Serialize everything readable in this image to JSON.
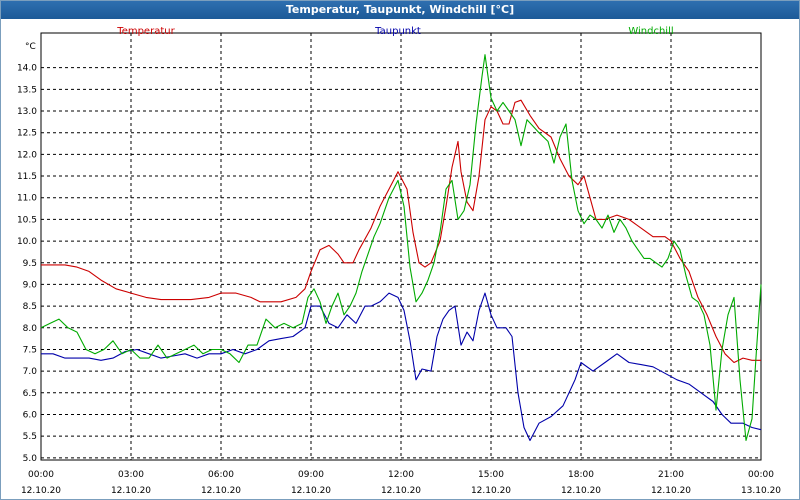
{
  "window": {
    "title": "Temperatur, Taupunkt, Windchill [°C]"
  },
  "chart_data": {
    "type": "line",
    "title": "Temperatur, Taupunkt, Windchill [°C]",
    "ylabel": "°C",
    "ylim": [
      4.95,
      14.8
    ],
    "xlim": [
      0,
      24
    ],
    "grid": true,
    "legend_position": "top",
    "y_ticks": [
      "5.0",
      "5.5",
      "6.0",
      "6.5",
      "7.0",
      "7.5",
      "8.0",
      "8.5",
      "9.0",
      "9.5",
      "10.0",
      "10.5",
      "11.0",
      "11.5",
      "12.0",
      "12.5",
      "13.0",
      "13.5",
      "14.0"
    ],
    "x_ticks": [
      {
        "time": "00:00",
        "date": "12.10.20"
      },
      {
        "time": "03:00",
        "date": "12.10.20"
      },
      {
        "time": "06:00",
        "date": "12.10.20"
      },
      {
        "time": "09:00",
        "date": "12.10.20"
      },
      {
        "time": "12:00",
        "date": "12.10.20"
      },
      {
        "time": "15:00",
        "date": "12.10.20"
      },
      {
        "time": "18:00",
        "date": "12.10.20"
      },
      {
        "time": "21:00",
        "date": "12.10.20"
      },
      {
        "time": "00:00",
        "date": "13.10.20"
      }
    ],
    "series": [
      {
        "name": "Temperatur",
        "color": "#cc0000",
        "points": [
          [
            0,
            9.45
          ],
          [
            0.8,
            9.45
          ],
          [
            1.2,
            9.4
          ],
          [
            1.6,
            9.3
          ],
          [
            2.0,
            9.1
          ],
          [
            2.5,
            8.9
          ],
          [
            3.0,
            8.8
          ],
          [
            3.5,
            8.7
          ],
          [
            4.0,
            8.65
          ],
          [
            5.0,
            8.65
          ],
          [
            5.6,
            8.7
          ],
          [
            6.0,
            8.8
          ],
          [
            6.5,
            8.8
          ],
          [
            7.0,
            8.7
          ],
          [
            7.3,
            8.6
          ],
          [
            7.6,
            8.6
          ],
          [
            8.0,
            8.6
          ],
          [
            8.5,
            8.7
          ],
          [
            8.8,
            8.9
          ],
          [
            9.0,
            9.3
          ],
          [
            9.3,
            9.8
          ],
          [
            9.6,
            9.9
          ],
          [
            9.9,
            9.7
          ],
          [
            10.1,
            9.5
          ],
          [
            10.4,
            9.5
          ],
          [
            10.6,
            9.8
          ],
          [
            11.0,
            10.3
          ],
          [
            11.3,
            10.8
          ],
          [
            11.6,
            11.2
          ],
          [
            11.9,
            11.6
          ],
          [
            12.2,
            11.2
          ],
          [
            12.4,
            10.2
          ],
          [
            12.6,
            9.5
          ],
          [
            12.8,
            9.4
          ],
          [
            13.0,
            9.5
          ],
          [
            13.3,
            10.0
          ],
          [
            13.5,
            10.8
          ],
          [
            13.7,
            11.7
          ],
          [
            13.9,
            12.3
          ],
          [
            14.0,
            11.6
          ],
          [
            14.2,
            10.9
          ],
          [
            14.4,
            10.7
          ],
          [
            14.6,
            11.5
          ],
          [
            14.8,
            12.8
          ],
          [
            15.0,
            13.1
          ],
          [
            15.2,
            13.0
          ],
          [
            15.4,
            12.7
          ],
          [
            15.6,
            12.7
          ],
          [
            15.8,
            13.2
          ],
          [
            16.0,
            13.25
          ],
          [
            16.3,
            12.9
          ],
          [
            16.6,
            12.6
          ],
          [
            17.0,
            12.4
          ],
          [
            17.3,
            11.9
          ],
          [
            17.6,
            11.5
          ],
          [
            17.9,
            11.3
          ],
          [
            18.1,
            11.5
          ],
          [
            18.3,
            11.0
          ],
          [
            18.5,
            10.5
          ],
          [
            18.8,
            10.5
          ],
          [
            19.2,
            10.6
          ],
          [
            19.6,
            10.5
          ],
          [
            20.0,
            10.3
          ],
          [
            20.4,
            10.1
          ],
          [
            20.8,
            10.1
          ],
          [
            21.0,
            10.0
          ],
          [
            21.3,
            9.6
          ],
          [
            21.6,
            9.3
          ],
          [
            21.9,
            8.7
          ],
          [
            22.2,
            8.3
          ],
          [
            22.5,
            7.8
          ],
          [
            22.8,
            7.4
          ],
          [
            23.1,
            7.2
          ],
          [
            23.4,
            7.3
          ],
          [
            23.7,
            7.25
          ],
          [
            24.0,
            7.25
          ]
        ]
      },
      {
        "name": "Taupunkt",
        "color": "#0000aa",
        "points": [
          [
            0,
            7.4
          ],
          [
            0.4,
            7.4
          ],
          [
            0.8,
            7.3
          ],
          [
            1.2,
            7.3
          ],
          [
            1.6,
            7.3
          ],
          [
            2.0,
            7.25
          ],
          [
            2.4,
            7.3
          ],
          [
            2.8,
            7.45
          ],
          [
            3.2,
            7.5
          ],
          [
            3.6,
            7.4
          ],
          [
            4.0,
            7.3
          ],
          [
            4.4,
            7.35
          ],
          [
            4.8,
            7.4
          ],
          [
            5.2,
            7.3
          ],
          [
            5.6,
            7.4
          ],
          [
            6.0,
            7.4
          ],
          [
            6.4,
            7.5
          ],
          [
            6.8,
            7.4
          ],
          [
            7.2,
            7.5
          ],
          [
            7.6,
            7.7
          ],
          [
            8.0,
            7.75
          ],
          [
            8.4,
            7.8
          ],
          [
            8.8,
            8.0
          ],
          [
            9.0,
            8.5
          ],
          [
            9.3,
            8.5
          ],
          [
            9.6,
            8.1
          ],
          [
            9.9,
            8.0
          ],
          [
            10.2,
            8.3
          ],
          [
            10.5,
            8.1
          ],
          [
            10.8,
            8.5
          ],
          [
            11.0,
            8.5
          ],
          [
            11.3,
            8.6
          ],
          [
            11.6,
            8.8
          ],
          [
            11.9,
            8.7
          ],
          [
            12.1,
            8.4
          ],
          [
            12.3,
            7.7
          ],
          [
            12.5,
            6.8
          ],
          [
            12.7,
            7.05
          ],
          [
            13.0,
            7.0
          ],
          [
            13.2,
            7.8
          ],
          [
            13.4,
            8.2
          ],
          [
            13.6,
            8.4
          ],
          [
            13.8,
            8.5
          ],
          [
            14.0,
            7.6
          ],
          [
            14.2,
            7.9
          ],
          [
            14.4,
            7.7
          ],
          [
            14.6,
            8.4
          ],
          [
            14.8,
            8.8
          ],
          [
            15.0,
            8.3
          ],
          [
            15.2,
            8.0
          ],
          [
            15.5,
            8.0
          ],
          [
            15.7,
            7.8
          ],
          [
            15.9,
            6.5
          ],
          [
            16.1,
            5.7
          ],
          [
            16.3,
            5.4
          ],
          [
            16.6,
            5.8
          ],
          [
            17.0,
            5.95
          ],
          [
            17.4,
            6.2
          ],
          [
            17.8,
            6.8
          ],
          [
            18.0,
            7.2
          ],
          [
            18.4,
            7.0
          ],
          [
            18.8,
            7.2
          ],
          [
            19.2,
            7.4
          ],
          [
            19.6,
            7.2
          ],
          [
            20.0,
            7.15
          ],
          [
            20.4,
            7.1
          ],
          [
            20.8,
            6.95
          ],
          [
            21.2,
            6.8
          ],
          [
            21.6,
            6.7
          ],
          [
            22.0,
            6.5
          ],
          [
            22.4,
            6.3
          ],
          [
            22.7,
            6.0
          ],
          [
            23.0,
            5.8
          ],
          [
            23.4,
            5.8
          ],
          [
            23.7,
            5.7
          ],
          [
            24.0,
            5.65
          ]
        ]
      },
      {
        "name": "Windchill",
        "color": "#00aa00",
        "points": [
          [
            0,
            8.0
          ],
          [
            0.3,
            8.1
          ],
          [
            0.6,
            8.2
          ],
          [
            0.9,
            8.0
          ],
          [
            1.2,
            7.9
          ],
          [
            1.5,
            7.5
          ],
          [
            1.8,
            7.4
          ],
          [
            2.1,
            7.5
          ],
          [
            2.4,
            7.7
          ],
          [
            2.7,
            7.4
          ],
          [
            3.0,
            7.5
          ],
          [
            3.3,
            7.3
          ],
          [
            3.6,
            7.3
          ],
          [
            3.9,
            7.6
          ],
          [
            4.2,
            7.3
          ],
          [
            4.5,
            7.4
          ],
          [
            4.8,
            7.5
          ],
          [
            5.1,
            7.6
          ],
          [
            5.4,
            7.4
          ],
          [
            5.7,
            7.5
          ],
          [
            6.0,
            7.5
          ],
          [
            6.3,
            7.4
          ],
          [
            6.6,
            7.2
          ],
          [
            6.9,
            7.6
          ],
          [
            7.2,
            7.6
          ],
          [
            7.5,
            8.2
          ],
          [
            7.8,
            8.0
          ],
          [
            8.1,
            8.1
          ],
          [
            8.4,
            8.0
          ],
          [
            8.7,
            8.1
          ],
          [
            8.9,
            8.7
          ],
          [
            9.1,
            8.9
          ],
          [
            9.3,
            8.6
          ],
          [
            9.5,
            8.1
          ],
          [
            9.7,
            8.5
          ],
          [
            9.9,
            8.8
          ],
          [
            10.1,
            8.3
          ],
          [
            10.3,
            8.5
          ],
          [
            10.5,
            8.8
          ],
          [
            10.7,
            9.3
          ],
          [
            10.9,
            9.7
          ],
          [
            11.1,
            10.1
          ],
          [
            11.3,
            10.4
          ],
          [
            11.6,
            11.0
          ],
          [
            11.9,
            11.4
          ],
          [
            12.1,
            10.8
          ],
          [
            12.3,
            9.4
          ],
          [
            12.5,
            8.6
          ],
          [
            12.7,
            8.8
          ],
          [
            12.9,
            9.1
          ],
          [
            13.1,
            9.5
          ],
          [
            13.3,
            10.2
          ],
          [
            13.5,
            11.2
          ],
          [
            13.7,
            11.4
          ],
          [
            13.9,
            10.5
          ],
          [
            14.1,
            10.7
          ],
          [
            14.3,
            11.3
          ],
          [
            14.5,
            12.7
          ],
          [
            14.7,
            13.8
          ],
          [
            14.8,
            14.3
          ],
          [
            15.0,
            13.3
          ],
          [
            15.2,
            13.0
          ],
          [
            15.4,
            13.2
          ],
          [
            15.6,
            13.0
          ],
          [
            15.8,
            12.8
          ],
          [
            16.0,
            12.2
          ],
          [
            16.2,
            12.8
          ],
          [
            16.6,
            12.5
          ],
          [
            16.9,
            12.3
          ],
          [
            17.1,
            11.8
          ],
          [
            17.3,
            12.4
          ],
          [
            17.5,
            12.7
          ],
          [
            17.7,
            11.4
          ],
          [
            17.9,
            10.7
          ],
          [
            18.1,
            10.4
          ],
          [
            18.3,
            10.6
          ],
          [
            18.5,
            10.5
          ],
          [
            18.7,
            10.3
          ],
          [
            18.9,
            10.6
          ],
          [
            19.1,
            10.2
          ],
          [
            19.3,
            10.5
          ],
          [
            19.5,
            10.3
          ],
          [
            19.7,
            10.0
          ],
          [
            19.9,
            9.8
          ],
          [
            20.1,
            9.6
          ],
          [
            20.3,
            9.6
          ],
          [
            20.5,
            9.5
          ],
          [
            20.7,
            9.4
          ],
          [
            20.9,
            9.6
          ],
          [
            21.1,
            10.0
          ],
          [
            21.3,
            9.8
          ],
          [
            21.5,
            9.2
          ],
          [
            21.7,
            8.7
          ],
          [
            21.9,
            8.6
          ],
          [
            22.1,
            8.3
          ],
          [
            22.3,
            7.6
          ],
          [
            22.5,
            6.1
          ],
          [
            22.7,
            7.5
          ],
          [
            22.9,
            8.3
          ],
          [
            23.1,
            8.7
          ],
          [
            23.3,
            6.8
          ],
          [
            23.5,
            5.4
          ],
          [
            23.7,
            5.9
          ],
          [
            23.85,
            7.5
          ],
          [
            24.0,
            9.0
          ]
        ]
      }
    ]
  }
}
